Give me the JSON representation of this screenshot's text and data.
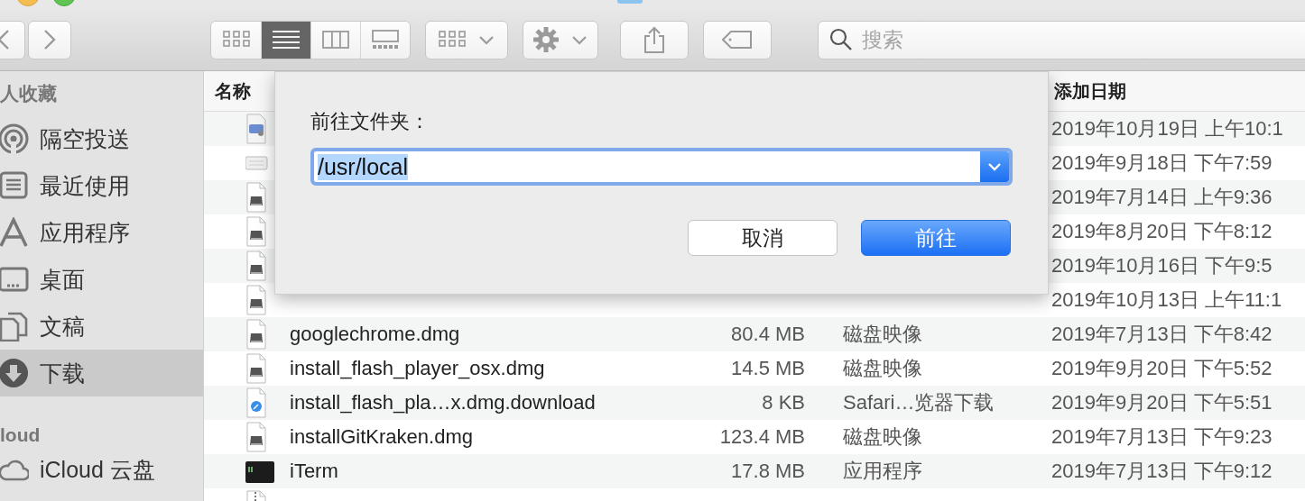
{
  "toolbar": {
    "view_modes": [
      {
        "kind": "icons",
        "selected": false
      },
      {
        "kind": "list",
        "selected": true
      },
      {
        "kind": "columns",
        "selected": false
      },
      {
        "kind": "gallery",
        "selected": false
      }
    ],
    "search": {
      "placeholder": "搜索"
    }
  },
  "sidebar": {
    "sections": [
      {
        "title": "人收藏",
        "items": [
          {
            "kind": "airdrop",
            "label": "隔空投送",
            "selected": false
          },
          {
            "kind": "recents",
            "label": "最近使用",
            "selected": false
          },
          {
            "kind": "applications",
            "label": "应用程序",
            "selected": false
          },
          {
            "kind": "desktop",
            "label": "桌面",
            "selected": false
          },
          {
            "kind": "documents",
            "label": "文稿",
            "selected": false
          },
          {
            "kind": "downloads",
            "label": "下载",
            "selected": true
          }
        ]
      },
      {
        "title": "loud",
        "items": [
          {
            "kind": "cloud",
            "label": "iCloud 云盘",
            "selected": false
          }
        ]
      }
    ]
  },
  "table": {
    "columns": [
      "名称",
      "添加日期"
    ],
    "rows": [
      {
        "kind": "installer",
        "date": "2019年10月19日 上午10:1"
      },
      {
        "kind": "card",
        "date": "2019年9月18日 下午7:59"
      },
      {
        "kind": "dmg",
        "date": "2019年7月14日 上午9:36"
      },
      {
        "kind": "dmg",
        "date": "2019年8月20日 下午8:12"
      },
      {
        "kind": "dmg",
        "date": "2019年10月16日 下午9:5"
      },
      {
        "kind": "dmg",
        "date": "2019年10月13日 上午11:1"
      },
      {
        "kind": "dmg",
        "name": "googlechrome.dmg",
        "size": "80.4 MB",
        "type": "磁盘映像",
        "date": "2019年7月13日 下午8:42"
      },
      {
        "kind": "dmg",
        "name": "install_flash_player_osx.dmg",
        "size": "14.5 MB",
        "type": "磁盘映像",
        "date": "2019年9月20日 下午5:52"
      },
      {
        "kind": "safari",
        "name": "install_flash_pla…x.dmg.download",
        "size": "8 KB",
        "type": "Safari…览器下载",
        "date": "2019年9月20日 下午5:51"
      },
      {
        "kind": "dmg",
        "name": "installGitKraken.dmg",
        "size": "123.4 MB",
        "type": "磁盘映像",
        "date": "2019年7月13日 下午9:23"
      },
      {
        "kind": "terminal",
        "name": "iTerm",
        "size": "17.8 MB",
        "type": "应用程序",
        "date": "2019年7月13日 下午9:12"
      },
      {
        "kind": "zip"
      }
    ]
  },
  "dialog": {
    "title": "前往文件夹：",
    "value": "/usr/local",
    "value_selected": true,
    "buttons": [
      {
        "label": "取消",
        "default": false
      },
      {
        "label": "前往",
        "default": true
      }
    ]
  }
}
